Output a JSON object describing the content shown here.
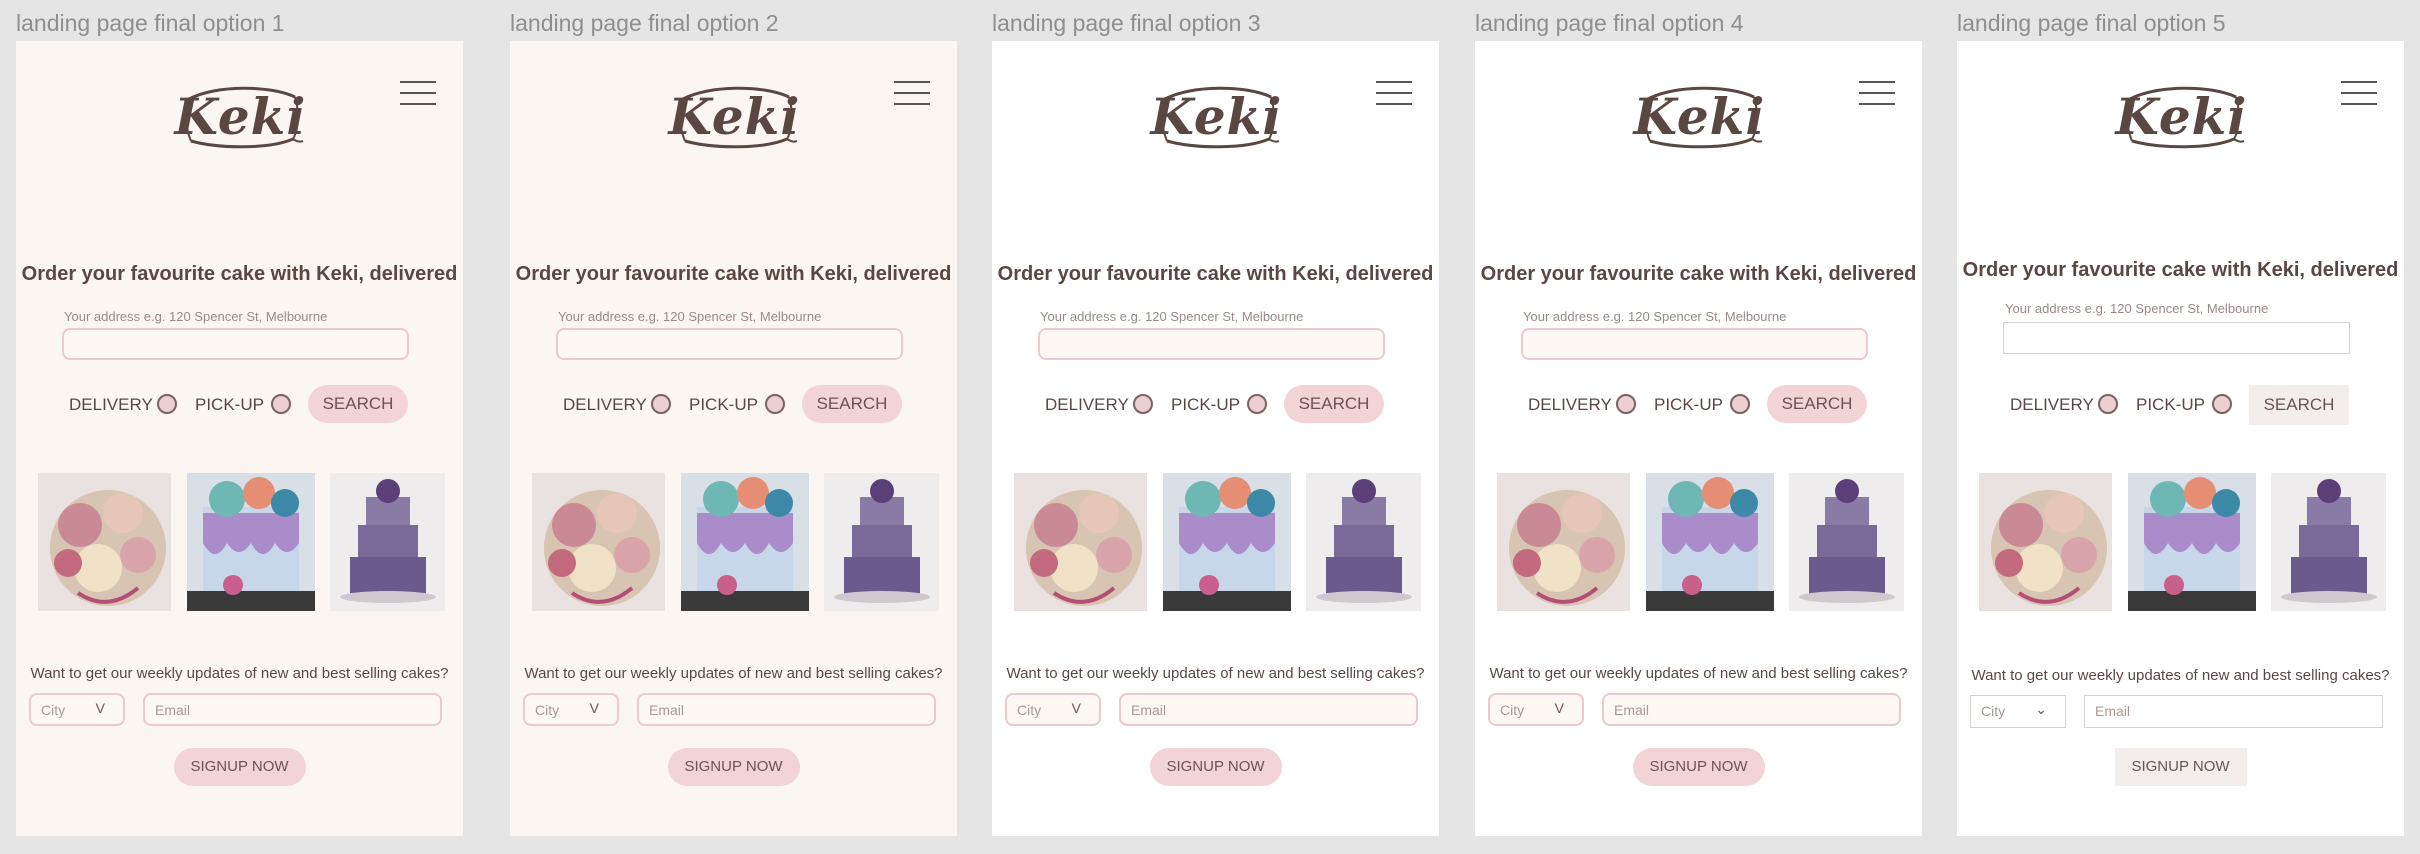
{
  "frames": [
    {
      "label": "landing page final option 1",
      "bg": "#fcf6f2",
      "style": "rounded"
    },
    {
      "label": "landing page final option 2",
      "bg": "#fcf6f2",
      "style": "rounded"
    },
    {
      "label": "landing page final option 3",
      "bg": "#ffffff",
      "style": "rounded"
    },
    {
      "label": "landing page final option 4",
      "bg": "#ffffff",
      "style": "rounded"
    },
    {
      "label": "landing page final option 5",
      "bg": "#ffffff",
      "style": "flat"
    }
  ],
  "logo": {
    "text": "Keki"
  },
  "hero": {
    "headline": "Order your favourite cake with Keki, delivered"
  },
  "address": {
    "label": "Your address e.g. 120 Spencer St, Melbourne"
  },
  "options": {
    "delivery": "DELIVERY",
    "pickup": "PICK-UP",
    "search": "SEARCH"
  },
  "newsletter": {
    "prompt": "Want to get our weekly updates of new and best selling cakes?",
    "city_placeholder": "City",
    "city_chevron": "V",
    "city_chevron_flat": "⌄",
    "email_placeholder": "Email",
    "signup": "SIGNUP NOW"
  },
  "icons": {
    "menu": "hamburger-menu-icon"
  },
  "colors": {
    "text": "#5b4742",
    "accent_pink": "#f2d4d6",
    "border_pink": "#ecc9cc",
    "cream_bg": "#fcf6f2"
  }
}
